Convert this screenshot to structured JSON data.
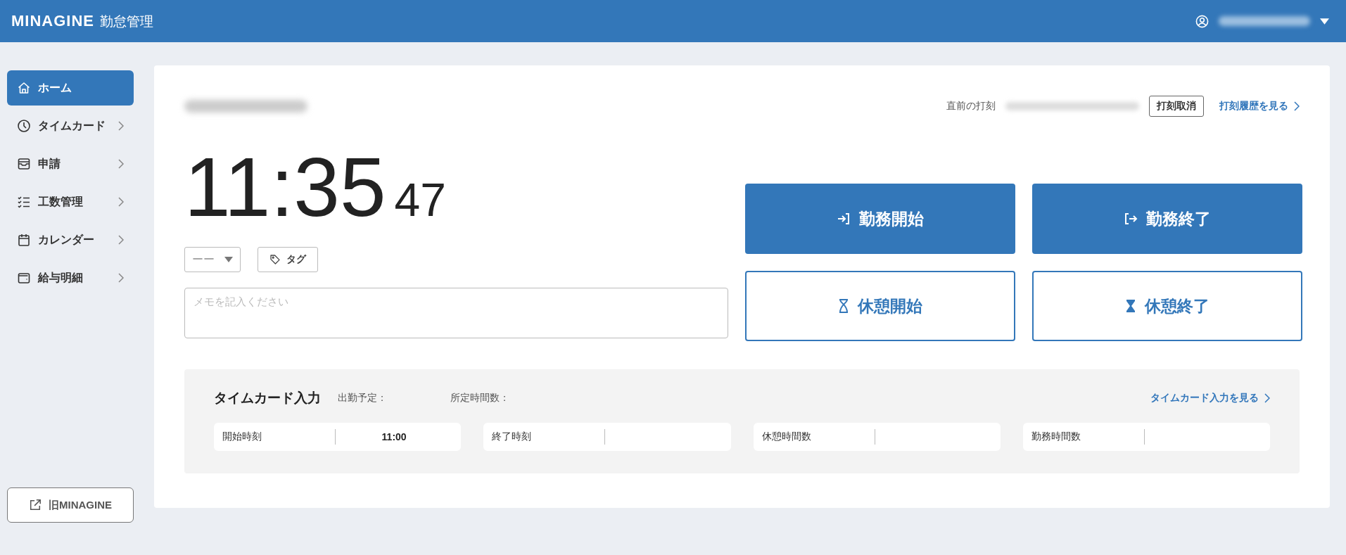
{
  "header": {
    "logo": "MINAGINE",
    "app_name": "勤怠管理"
  },
  "sidebar": {
    "items": [
      {
        "label": "ホーム",
        "selected": true,
        "has_submenu": false
      },
      {
        "label": "タイムカード",
        "selected": false,
        "has_submenu": true
      },
      {
        "label": "申請",
        "selected": false,
        "has_submenu": true
      },
      {
        "label": "工数管理",
        "selected": false,
        "has_submenu": true
      },
      {
        "label": "カレンダー",
        "selected": false,
        "has_submenu": true
      },
      {
        "label": "給与明細",
        "selected": false,
        "has_submenu": true
      }
    ],
    "footer_button": "旧MINAGINE"
  },
  "punch": {
    "last_label": "直前の打刻",
    "cancel_button": "打刻取消",
    "history_link": "打刻履歴を見る"
  },
  "clock": {
    "time": "11:35",
    "seconds": "47"
  },
  "select": {
    "value": "ーー"
  },
  "tag_button": "タグ",
  "memo": {
    "placeholder": "メモを記入ください"
  },
  "actions": [
    {
      "label": "勤務開始",
      "kind": "primary"
    },
    {
      "label": "勤務終了",
      "kind": "primary"
    },
    {
      "label": "休憩開始",
      "kind": "outline"
    },
    {
      "label": "休憩終了",
      "kind": "outline"
    }
  ],
  "timecard": {
    "title": "タイムカード入力",
    "scheduled_label": "出勤予定：",
    "hours_label": "所定時間数：",
    "link": "タイムカード入力を見る",
    "fields": [
      {
        "label": "開始時刻",
        "value": "11:00"
      },
      {
        "label": "終了時刻"
      },
      {
        "label": "休憩時間数"
      },
      {
        "label": "勤務時間数"
      }
    ]
  }
}
